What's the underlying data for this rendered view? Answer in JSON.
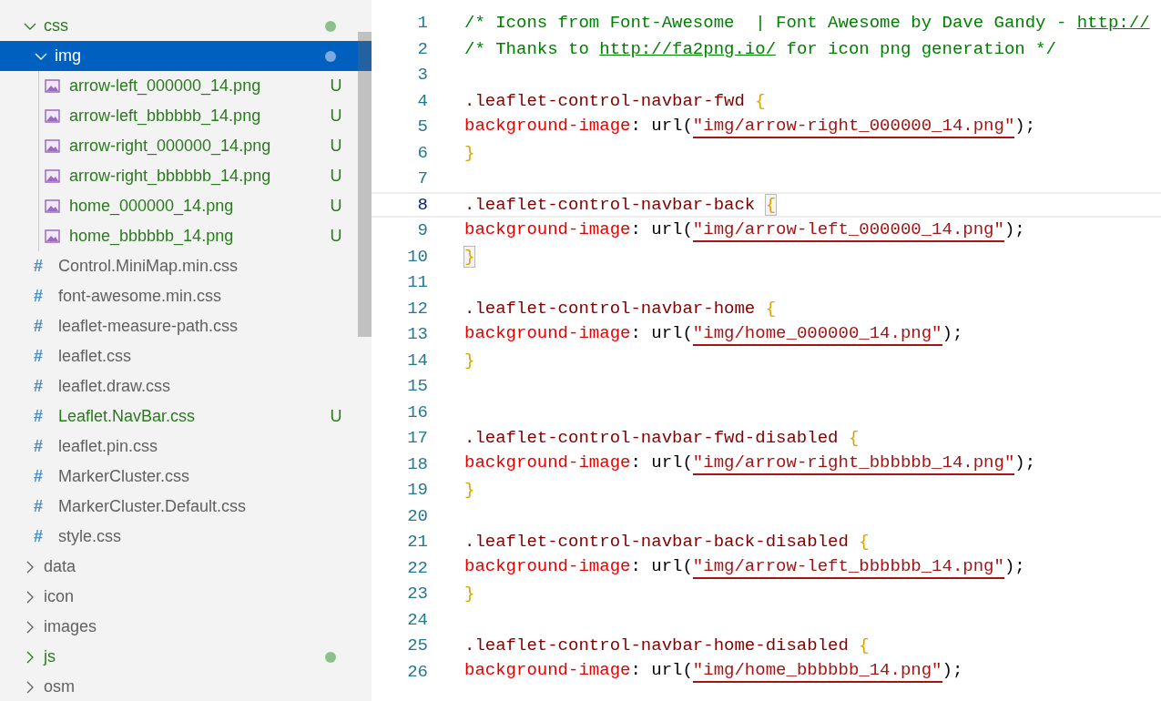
{
  "explorer": {
    "items": [
      {
        "name": "css",
        "kind": "folder",
        "expanded": true,
        "selected": false,
        "git": true,
        "dot": true,
        "children": [
          {
            "name": "img",
            "kind": "folder",
            "expanded": true,
            "selected": true,
            "git": true,
            "dot": true,
            "children": [
              {
                "name": "arrow-left_000000_14.png",
                "kind": "image",
                "selected": false,
                "git": true,
                "status": "U"
              },
              {
                "name": "arrow-left_bbbbbb_14.png",
                "kind": "image",
                "selected": false,
                "git": true,
                "status": "U"
              },
              {
                "name": "arrow-right_000000_14.png",
                "kind": "image",
                "selected": false,
                "git": true,
                "status": "U"
              },
              {
                "name": "arrow-right_bbbbbb_14.png",
                "kind": "image",
                "selected": false,
                "git": true,
                "status": "U"
              },
              {
                "name": "home_000000_14.png",
                "kind": "image",
                "selected": false,
                "git": true,
                "status": "U"
              },
              {
                "name": "home_bbbbbb_14.png",
                "kind": "image",
                "selected": false,
                "git": true,
                "status": "U"
              }
            ]
          },
          {
            "name": "Control.MiniMap.min.css",
            "kind": "css",
            "glyph": "#",
            "selected": false,
            "git": false
          },
          {
            "name": "font-awesome.min.css",
            "kind": "css",
            "glyph": "#",
            "selected": false,
            "git": false
          },
          {
            "name": "leaflet-measure-path.css",
            "kind": "css",
            "glyph": "#",
            "selected": false,
            "git": false
          },
          {
            "name": "leaflet.css",
            "kind": "css",
            "glyph": "#",
            "selected": false,
            "git": false
          },
          {
            "name": "leaflet.draw.css",
            "kind": "css",
            "glyph": "#",
            "selected": false,
            "git": false
          },
          {
            "name": "Leaflet.NavBar.css",
            "kind": "css",
            "glyph": "#",
            "selected": false,
            "git": true,
            "status": "U"
          },
          {
            "name": "leaflet.pin.css",
            "kind": "css",
            "glyph": "#",
            "selected": false,
            "git": false
          },
          {
            "name": "MarkerCluster.css",
            "kind": "css",
            "glyph": "#",
            "selected": false,
            "git": false
          },
          {
            "name": "MarkerCluster.Default.css",
            "kind": "css",
            "glyph": "#",
            "selected": false,
            "git": false
          },
          {
            "name": "style.css",
            "kind": "css",
            "glyph": "#",
            "selected": false,
            "git": false
          }
        ]
      },
      {
        "name": "data",
        "kind": "folder",
        "expanded": false,
        "selected": false,
        "git": false,
        "dot": false
      },
      {
        "name": "icon",
        "kind": "folder",
        "expanded": false,
        "selected": false,
        "git": false,
        "dot": false
      },
      {
        "name": "images",
        "kind": "folder",
        "expanded": false,
        "selected": false,
        "git": false,
        "dot": false
      },
      {
        "name": "js",
        "kind": "folder",
        "expanded": false,
        "selected": false,
        "git": true,
        "dot": true
      },
      {
        "name": "osm",
        "kind": "folder",
        "expanded": false,
        "selected": false,
        "git": false,
        "dot": false
      }
    ]
  },
  "editor": {
    "lines": [
      {
        "number": "1",
        "current": false,
        "tokens": [
          {
            "kind": "comment",
            "text": "/* Icons from Font-Awesome  | Font Awesome by Dave Gandy - "
          },
          {
            "kind": "link",
            "text": "http://"
          }
        ]
      },
      {
        "number": "2",
        "current": false,
        "tokens": [
          {
            "kind": "comment",
            "text": "/* Thanks to "
          },
          {
            "kind": "link",
            "text": "http://fa2png.io/"
          },
          {
            "kind": "comment",
            "text": " for icon png generation */"
          }
        ]
      },
      {
        "number": "3",
        "current": false
      },
      {
        "number": "4",
        "current": false,
        "tokens": [
          {
            "kind": "selector",
            "text": ".leaflet-control-navbar-fwd "
          },
          {
            "kind": "brace",
            "text": "{"
          }
        ]
      },
      {
        "number": "5",
        "current": false,
        "tokens": [
          {
            "kind": "property",
            "text": "background-image"
          },
          {
            "kind": "plain",
            "text": ": url("
          },
          {
            "kind": "string",
            "text": "\"img/arrow-right_000000_14.png\""
          },
          {
            "kind": "plain",
            "text": ");"
          }
        ]
      },
      {
        "number": "6",
        "current": false,
        "tokens": [
          {
            "kind": "brace",
            "text": "}"
          }
        ]
      },
      {
        "number": "7",
        "current": false
      },
      {
        "number": "8",
        "current": true,
        "tokens": [
          {
            "kind": "selector",
            "text": ".leaflet-control-navbar-back "
          },
          {
            "kind": "matched-brace",
            "text": "{"
          }
        ]
      },
      {
        "number": "9",
        "current": false,
        "tokens": [
          {
            "kind": "property",
            "text": "background-image"
          },
          {
            "kind": "plain",
            "text": ": url("
          },
          {
            "kind": "string",
            "text": "\"img/arrow-left_000000_14.png\""
          },
          {
            "kind": "plain",
            "text": ");"
          }
        ]
      },
      {
        "number": "10",
        "current": false,
        "tokens": [
          {
            "kind": "matched-brace",
            "text": "}"
          }
        ]
      },
      {
        "number": "11",
        "current": false
      },
      {
        "number": "12",
        "current": false,
        "tokens": [
          {
            "kind": "selector",
            "text": ".leaflet-control-navbar-home "
          },
          {
            "kind": "brace",
            "text": "{"
          }
        ]
      },
      {
        "number": "13",
        "current": false,
        "tokens": [
          {
            "kind": "property",
            "text": "background-image"
          },
          {
            "kind": "plain",
            "text": ": url("
          },
          {
            "kind": "string",
            "text": "\"img/home_000000_14.png\""
          },
          {
            "kind": "plain",
            "text": ");"
          }
        ]
      },
      {
        "number": "14",
        "current": false,
        "tokens": [
          {
            "kind": "brace",
            "text": "}"
          }
        ]
      },
      {
        "number": "15",
        "current": false
      },
      {
        "number": "16",
        "current": false
      },
      {
        "number": "17",
        "current": false,
        "tokens": [
          {
            "kind": "selector",
            "text": ".leaflet-control-navbar-fwd-disabled "
          },
          {
            "kind": "brace",
            "text": "{"
          }
        ]
      },
      {
        "number": "18",
        "current": false,
        "tokens": [
          {
            "kind": "property",
            "text": "background-image"
          },
          {
            "kind": "plain",
            "text": ": url("
          },
          {
            "kind": "string",
            "text": "\"img/arrow-right_bbbbbb_14.png\""
          },
          {
            "kind": "plain",
            "text": ");"
          }
        ]
      },
      {
        "number": "19",
        "current": false,
        "tokens": [
          {
            "kind": "brace",
            "text": "}"
          }
        ]
      },
      {
        "number": "20",
        "current": false
      },
      {
        "number": "21",
        "current": false,
        "tokens": [
          {
            "kind": "selector",
            "text": ".leaflet-control-navbar-back-disabled "
          },
          {
            "kind": "brace",
            "text": "{"
          }
        ]
      },
      {
        "number": "22",
        "current": false,
        "tokens": [
          {
            "kind": "property",
            "text": "background-image"
          },
          {
            "kind": "plain",
            "text": ": url("
          },
          {
            "kind": "string",
            "text": "\"img/arrow-left_bbbbbb_14.png\""
          },
          {
            "kind": "plain",
            "text": ");"
          }
        ]
      },
      {
        "number": "23",
        "current": false,
        "tokens": [
          {
            "kind": "brace",
            "text": "}"
          }
        ]
      },
      {
        "number": "24",
        "current": false
      },
      {
        "number": "25",
        "current": false,
        "tokens": [
          {
            "kind": "selector",
            "text": ".leaflet-control-navbar-home-disabled "
          },
          {
            "kind": "brace",
            "text": "{"
          }
        ]
      },
      {
        "number": "26",
        "current": false,
        "tokens": [
          {
            "kind": "property",
            "text": "background-image"
          },
          {
            "kind": "plain",
            "text": ": url("
          },
          {
            "kind": "string",
            "text": "\"img/home_bbbbbb_14.png\""
          },
          {
            "kind": "plain",
            "text": ");"
          }
        ]
      }
    ]
  }
}
